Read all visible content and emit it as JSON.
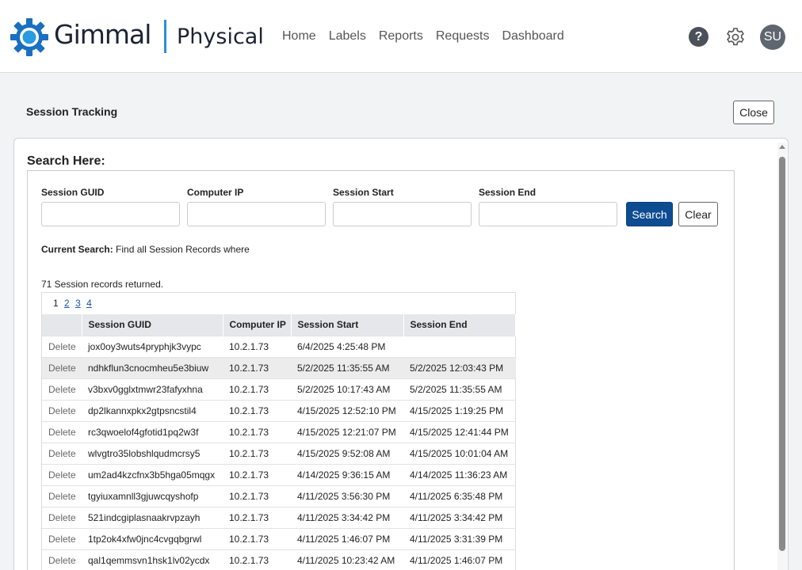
{
  "header": {
    "brand": "Gimmal",
    "product": "Physical",
    "nav": [
      "Home",
      "Labels",
      "Reports",
      "Requests",
      "Dashboard"
    ],
    "help_glyph": "?",
    "avatar_initials": "SU",
    "accent_color": "#2a8fd6"
  },
  "page": {
    "title": "Session Tracking",
    "close_label": "Close"
  },
  "search": {
    "heading": "Search Here:",
    "fields": [
      "Session GUID",
      "Computer IP",
      "Session Start",
      "Session End"
    ],
    "search_label": "Search",
    "clear_label": "Clear",
    "current_search_label": "Current Search:",
    "current_search_text": "Find all Session Records where",
    "records_count": "71 Session records returned."
  },
  "pager": {
    "current": "1",
    "pages": [
      "2",
      "3",
      "4"
    ]
  },
  "table": {
    "columns": [
      "",
      "Session GUID",
      "Computer IP",
      "Session Start",
      "Session End"
    ],
    "delete_label": "Delete",
    "rows": [
      {
        "guid": "jox0oy3wuts4pryphjk3vypc",
        "ip": "10.2.1.73",
        "start": "6/4/2025 4:25:48 PM",
        "end": ""
      },
      {
        "guid": "ndhkflun3cnocmheu5e3biuw",
        "ip": "10.2.1.73",
        "start": "5/2/2025 11:35:55 AM",
        "end": "5/2/2025 12:03:43 PM"
      },
      {
        "guid": "v3bxv0gglxtmwr23fafyxhna",
        "ip": "10.2.1.73",
        "start": "5/2/2025 10:17:43 AM",
        "end": "5/2/2025 11:35:55 AM"
      },
      {
        "guid": "dp2lkannxpkx2gtpsncstil4",
        "ip": "10.2.1.73",
        "start": "4/15/2025 12:52:10 PM",
        "end": "4/15/2025 1:19:25 PM"
      },
      {
        "guid": "rc3qwoelof4gfotid1pq2w3f",
        "ip": "10.2.1.73",
        "start": "4/15/2025 12:21:07 PM",
        "end": "4/15/2025 12:41:44 PM"
      },
      {
        "guid": "wlvgtro35lobshlqudmcrsy5",
        "ip": "10.2.1.73",
        "start": "4/15/2025 9:52:08 AM",
        "end": "4/15/2025 10:01:04 AM"
      },
      {
        "guid": "um2ad4kzcfnx3b5hga05mqgx",
        "ip": "10.2.1.73",
        "start": "4/14/2025 9:36:15 AM",
        "end": "4/14/2025 11:36:23 AM"
      },
      {
        "guid": "tgyiuxamnll3gjuwcqyshofp",
        "ip": "10.2.1.73",
        "start": "4/11/2025 3:56:30 PM",
        "end": "4/11/2025 6:35:48 PM"
      },
      {
        "guid": "521indcgiplasnaakrvpzayh",
        "ip": "10.2.1.73",
        "start": "4/11/2025 3:34:42 PM",
        "end": "4/11/2025 3:34:42 PM"
      },
      {
        "guid": "1tp2ok4xfw0jnc4cvgqbgrwl",
        "ip": "10.2.1.73",
        "start": "4/11/2025 1:46:07 PM",
        "end": "4/11/2025 3:31:39 PM"
      },
      {
        "guid": "qal1qemmsvn1hsk1lv02ycdx",
        "ip": "10.2.1.73",
        "start": "4/11/2025 10:23:42 AM",
        "end": "4/11/2025 1:46:07 PM"
      }
    ]
  }
}
